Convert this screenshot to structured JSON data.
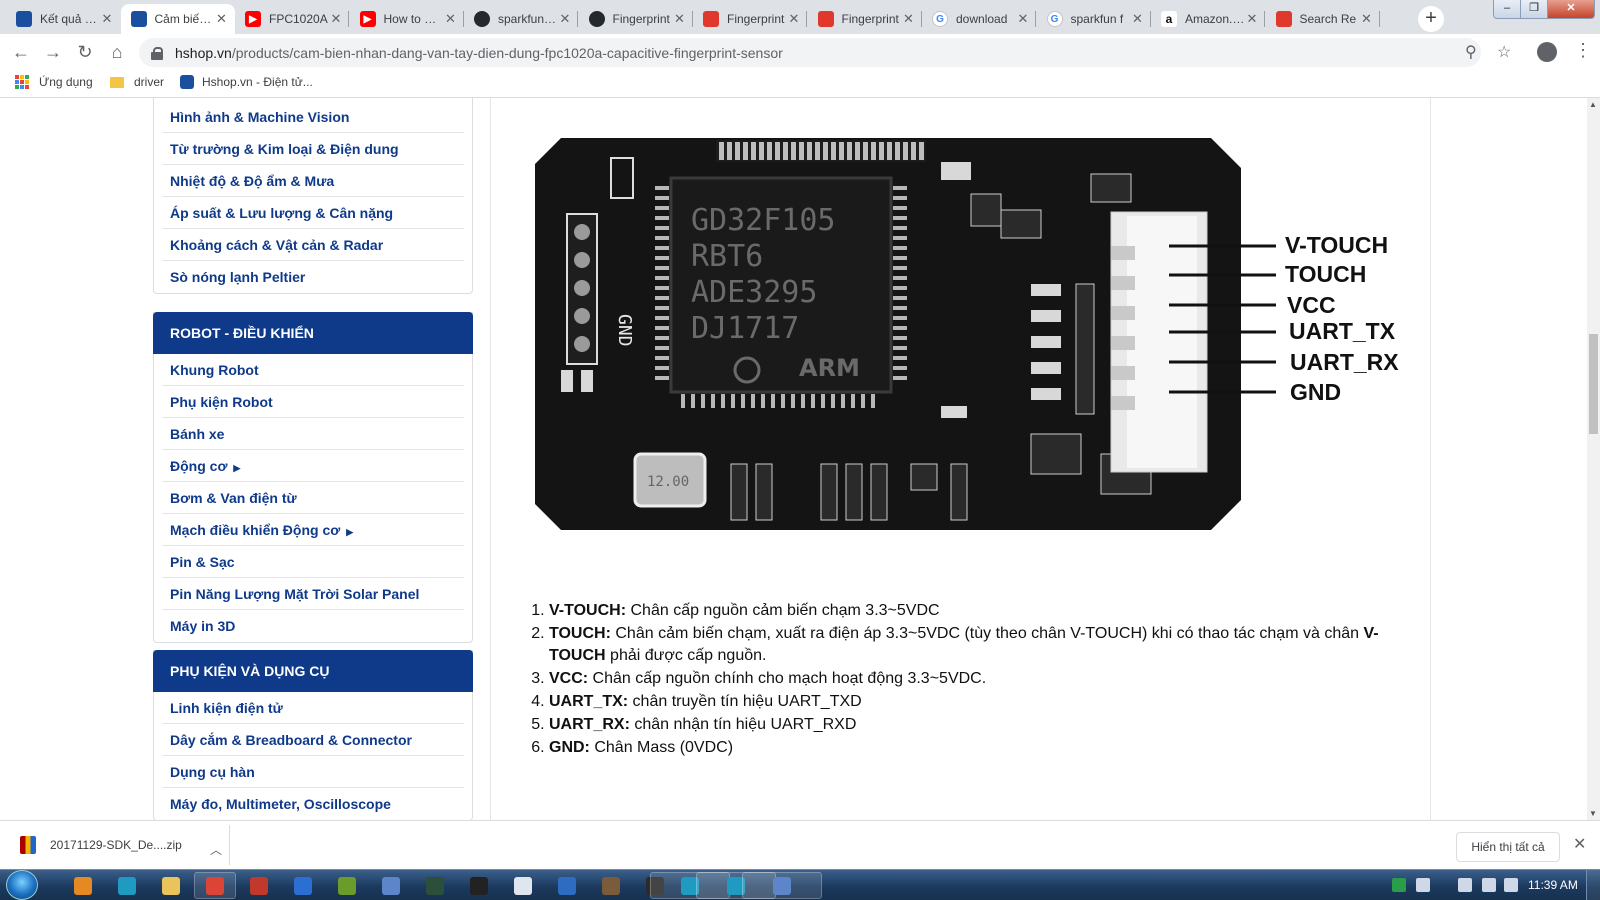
{
  "tabs": [
    {
      "title": "Kết quả tìm kiếm",
      "icon": "hshop-favicon-icon",
      "active": false
    },
    {
      "title": "Cảm biến nhận dạng",
      "icon": "hshop-favicon-icon",
      "active": true
    },
    {
      "title": "FPC1020A",
      "icon": "youtube-favicon-icon",
      "active": false
    },
    {
      "title": "How to Use",
      "icon": "youtube-favicon-icon",
      "active": false
    },
    {
      "title": "sparkfun/Fingerprint",
      "icon": "github-favicon-icon",
      "active": false
    },
    {
      "title": "Fingerprint",
      "icon": "github-favicon-icon",
      "active": false
    },
    {
      "title": "Fingerprint",
      "icon": "pdf-favicon-icon",
      "active": false
    },
    {
      "title": "Fingerprint",
      "icon": "pdf-favicon-icon",
      "active": false
    },
    {
      "title": "download",
      "icon": "google-favicon-icon",
      "active": false
    },
    {
      "title": "sparkfun f",
      "icon": "google-favicon-icon",
      "active": false
    },
    {
      "title": "Amazon.com",
      "icon": "amazon-favicon-icon",
      "active": false
    },
    {
      "title": "Search Re",
      "icon": "pdf-favicon-icon",
      "active": false
    }
  ],
  "address": {
    "host": "hshop.vn",
    "path": "/products/cam-bien-nhan-dang-van-tay-dien-dung-fpc1020a-capacitive-fingerprint-sensor"
  },
  "bookmarks": [
    {
      "label": "Ứng dụng",
      "icon": "apps-grid-icon"
    },
    {
      "label": "driver",
      "icon": "folder-icon"
    },
    {
      "label": "Hshop.vn - Điện tử...",
      "icon": "hshop-favicon-icon"
    }
  ],
  "sidebar": {
    "sensor_items": [
      {
        "label": "Hình ảnh & Machine Vision"
      },
      {
        "label": "Từ trường & Kim loại & Điện dung"
      },
      {
        "label": "Nhiệt độ & Độ ẩm & Mưa"
      },
      {
        "label": "Áp suất & Lưu lượng & Cân nặng"
      },
      {
        "label": "Khoảng cách & Vật cản & Radar"
      },
      {
        "label": "Sò nóng lạnh Peltier"
      }
    ],
    "robot": {
      "header": "ROBOT - ĐIỀU KHIỂN",
      "items": [
        {
          "label": "Khung Robot",
          "submenu": false
        },
        {
          "label": "Phụ kiện Robot",
          "submenu": false
        },
        {
          "label": "Bánh xe",
          "submenu": false
        },
        {
          "label": "Động cơ",
          "submenu": true
        },
        {
          "label": "Bơm & Van điện từ",
          "submenu": false
        },
        {
          "label": "Mạch điều khiển Động cơ",
          "submenu": true
        },
        {
          "label": "Pin & Sạc",
          "submenu": false
        },
        {
          "label": "Pin Năng Lượng Mặt Trời Solar Panel",
          "submenu": false
        },
        {
          "label": "Máy in 3D",
          "submenu": false
        }
      ]
    },
    "tools": {
      "header": "PHỤ KIỆN VÀ DỤNG CỤ",
      "items": [
        {
          "label": "Linh kiện điện tử"
        },
        {
          "label": "Dây cắm & Breadboard & Connector"
        },
        {
          "label": "Dụng cụ hàn"
        },
        {
          "label": "Máy đo, Multimeter, Oscilloscope"
        }
      ]
    }
  },
  "board": {
    "chip_lines": [
      "GD32F105",
      "RBT6",
      "ADE3295",
      "DJ1717"
    ],
    "chip_brand": "ARM",
    "crystal": "12.00",
    "pin_labels": [
      "V-TOUCH",
      "TOUCH",
      "VCC",
      "UART_TX",
      "UART_RX",
      "GND"
    ]
  },
  "pin_descriptions": [
    {
      "name": "V-TOUCH:",
      "text": " Chân cấp nguồn cảm biến chạm 3.3~5VDC"
    },
    {
      "name": "TOUCH:",
      "text": " Chân cảm biến chạm, xuất ra điện áp 3.3~5VDC (tùy theo chân V-TOUCH) khi có thao tác chạm và chân ",
      "name2": "V-TOUCH",
      "text2": " phải được cấp nguồn."
    },
    {
      "name": "VCC:",
      "text": " Chân cấp nguồn chính cho mạch hoạt động 3.3~5VDC."
    },
    {
      "name": "UART_TX:",
      "text": " chân truyền tín hiệu UART_TXD"
    },
    {
      "name": "UART_RX:",
      "text": " chân nhận tín hiệu UART_RXD"
    },
    {
      "name": "GND:",
      "text": " Chân Mass (0VDC)"
    }
  ],
  "downloads": {
    "file": "20171129-SDK_De....zip",
    "show_all": "Hiển thị tất cả"
  },
  "taskbar": {
    "clock": "11:39 AM"
  },
  "colors": {
    "sidebar_header": "#0f3a8a",
    "sidebar_link": "#0f3a8a",
    "pcb": "#141414"
  }
}
